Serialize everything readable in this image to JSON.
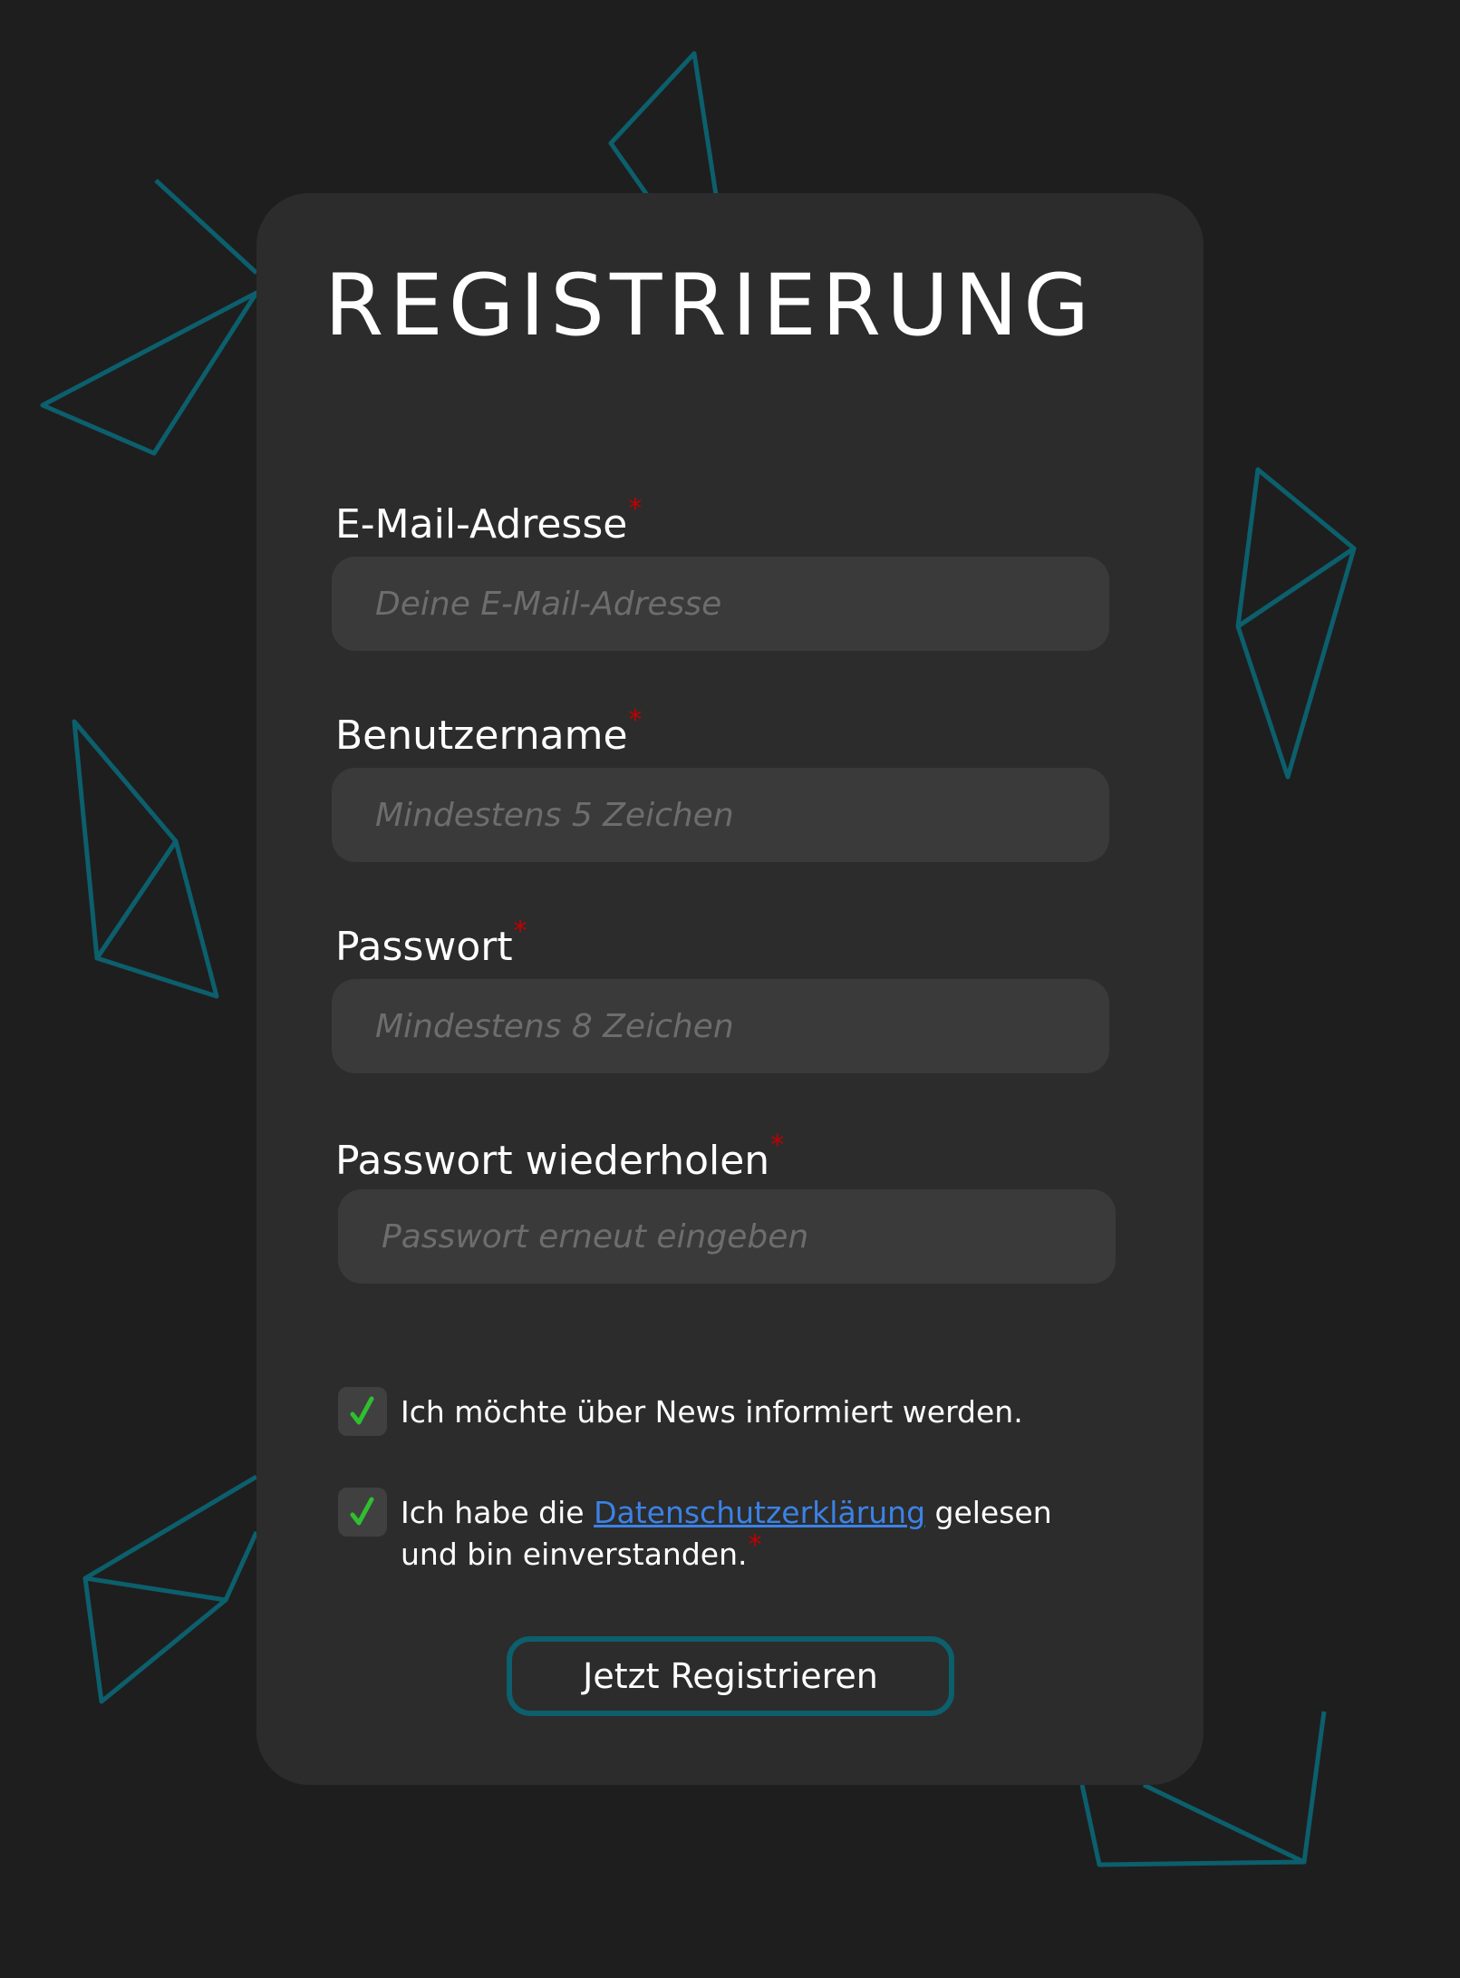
{
  "form": {
    "title": "REGISTRIERUNG",
    "required_marker": "*",
    "fields": [
      {
        "label": "E-Mail-Adresse",
        "placeholder": "Deine E-Mail-Adresse"
      },
      {
        "label": "Benutzername",
        "placeholder": "Mindestens 5 Zeichen"
      },
      {
        "label": "Passwort",
        "placeholder": "Mindestens 8 Zeichen"
      },
      {
        "label": "Passwort wiederholen",
        "placeholder": "Passwort erneut eingeben"
      }
    ],
    "newsletter": {
      "checked": true,
      "text": "Ich möchte über News informiert werden."
    },
    "privacy": {
      "checked": true,
      "text_before": "Ich habe die ",
      "link_text": "Datenschutzerklärung",
      "text_after": " gelesen",
      "text_line2": "und bin einverstanden."
    },
    "submit_label": "Jetzt Registrieren"
  },
  "colors": {
    "background": "#1e1e1e",
    "card": "#2c2c2c",
    "input": "#3a3a3a",
    "accent": "#0c5f6c",
    "required": "#c10000",
    "check": "#2fbf2f",
    "link": "#3b82e6"
  },
  "icons": {
    "checkbox_mark": "check-icon"
  }
}
